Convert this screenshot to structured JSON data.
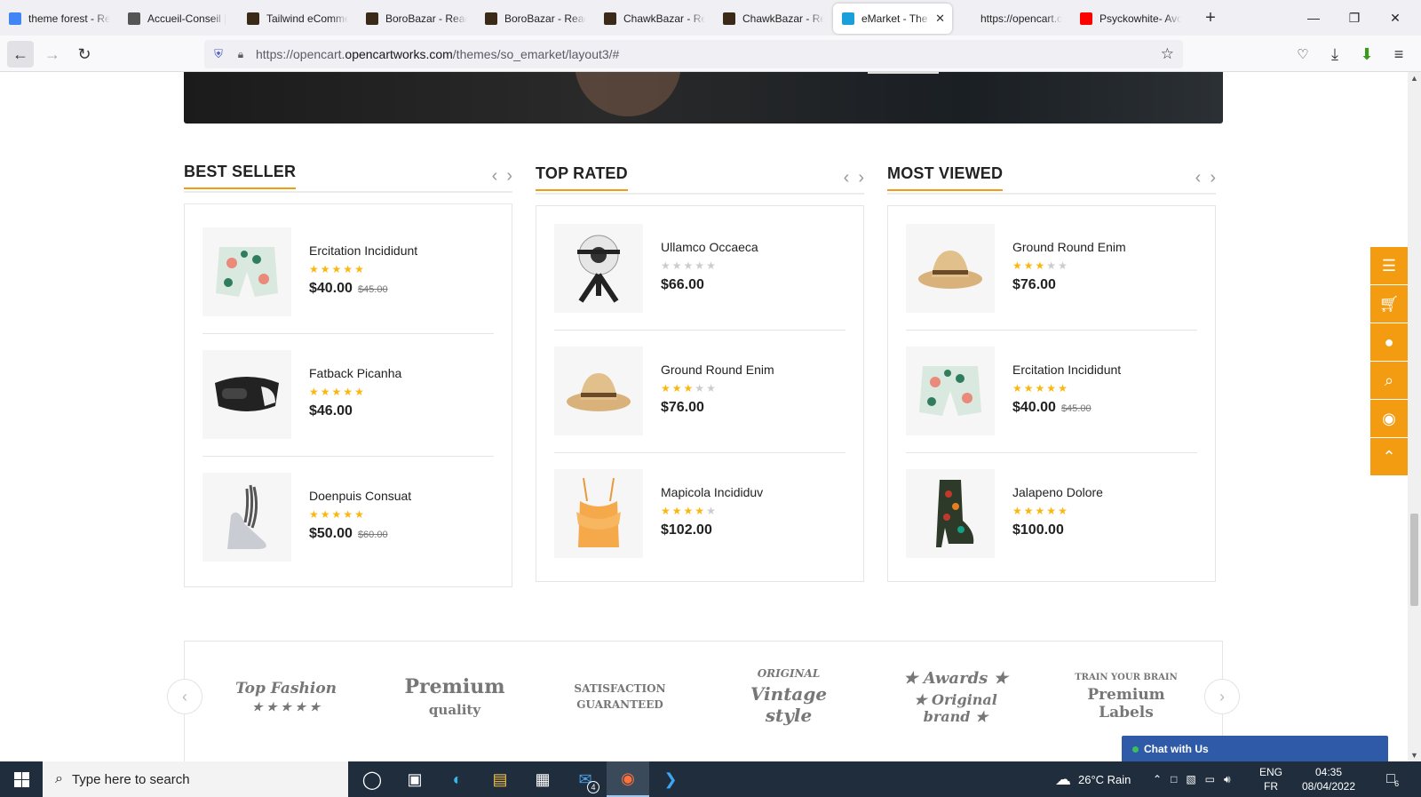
{
  "browser": {
    "tabs": [
      {
        "label": "theme forest - Re",
        "color": "#4285f4"
      },
      {
        "label": "Accueil-Conseil | ",
        "color": "#555555"
      },
      {
        "label": "Tailwind eComme",
        "color": "#3b2a18"
      },
      {
        "label": "BoroBazar - React",
        "color": "#3b2a18"
      },
      {
        "label": "BoroBazar - React",
        "color": "#3b2a18"
      },
      {
        "label": "ChawkBazar - Rea",
        "color": "#3b2a18"
      },
      {
        "label": "ChawkBazar - Rea",
        "color": "#3b2a18"
      },
      {
        "label": "eMarket - The e",
        "color": "#19a0d8",
        "active": true
      },
      {
        "label": "https://opencart.open",
        "color": "#ffffff"
      },
      {
        "label": "Psyckowhite- Avo",
        "color": "#ff0000"
      }
    ],
    "close_tab": "✕",
    "new_tab": "+",
    "url_prefix": "https://opencart.",
    "url_host": "opencartworks.com",
    "url_path": "/themes/so_emarket/layout3/#"
  },
  "sections": [
    {
      "title": "BEST SELLER",
      "products": [
        {
          "name": "Ercitation Incididunt",
          "rating": 5,
          "price": "$40.00",
          "old_price": "$45.00",
          "image": "shorts"
        },
        {
          "name": "Fatback Picanha",
          "rating": 5,
          "price": "$46.00",
          "old_price": "",
          "image": "vr-headset"
        },
        {
          "name": "Doenpuis Consuat",
          "rating": 5,
          "price": "$50.00",
          "old_price": "$60.00",
          "image": "heel"
        }
      ]
    },
    {
      "title": "TOP RATED",
      "products": [
        {
          "name": "Ullamco Occaeca",
          "rating": 0,
          "price": "$66.00",
          "old_price": "",
          "image": "camera"
        },
        {
          "name": "Ground Round Enim",
          "rating": 3,
          "price": "$76.00",
          "old_price": "",
          "image": "hat"
        },
        {
          "name": "Mapicola Incididuv",
          "rating": 4,
          "price": "$102.00",
          "old_price": "",
          "image": "top"
        }
      ]
    },
    {
      "title": "MOST VIEWED",
      "products": [
        {
          "name": "Ground Round Enim",
          "rating": 3,
          "price": "$76.00",
          "old_price": "",
          "image": "hat"
        },
        {
          "name": "Ercitation Incididunt",
          "rating": 5,
          "price": "$40.00",
          "old_price": "$45.00",
          "image": "shorts"
        },
        {
          "name": "Jalapeno Dolore",
          "rating": 5,
          "price": "$100.00",
          "old_price": "",
          "image": "boot"
        }
      ]
    }
  ],
  "brands": [
    {
      "line1": "Top Fashion",
      "line2": "★ ★ ★ ★ ★"
    },
    {
      "line1": "Premium",
      "line2": "quality"
    },
    {
      "line1": "SATISFACTION",
      "line2": "GUARANTEED"
    },
    {
      "line1": "ORIGINAL",
      "line2": "Vintage style"
    },
    {
      "line1": "★ Awards ★",
      "line2": "★ Original brand ★"
    },
    {
      "line1": "TRAIN YOUR BRAIN",
      "line2": "Premium Labels"
    }
  ],
  "sidebar_icons": [
    "menu-icon",
    "cart-icon",
    "user-icon",
    "search-icon",
    "eye-icon",
    "arrow-up-icon"
  ],
  "chat": {
    "label": "Chat with Us"
  },
  "taskbar": {
    "search_placeholder": "Type here to search",
    "mail_badge": "4",
    "weather": "26°C  Rain",
    "lang1": "ENG",
    "lang2": "FR",
    "time": "04:35",
    "date": "08/04/2022",
    "notif_count": "6"
  },
  "accent": "#f39c12"
}
